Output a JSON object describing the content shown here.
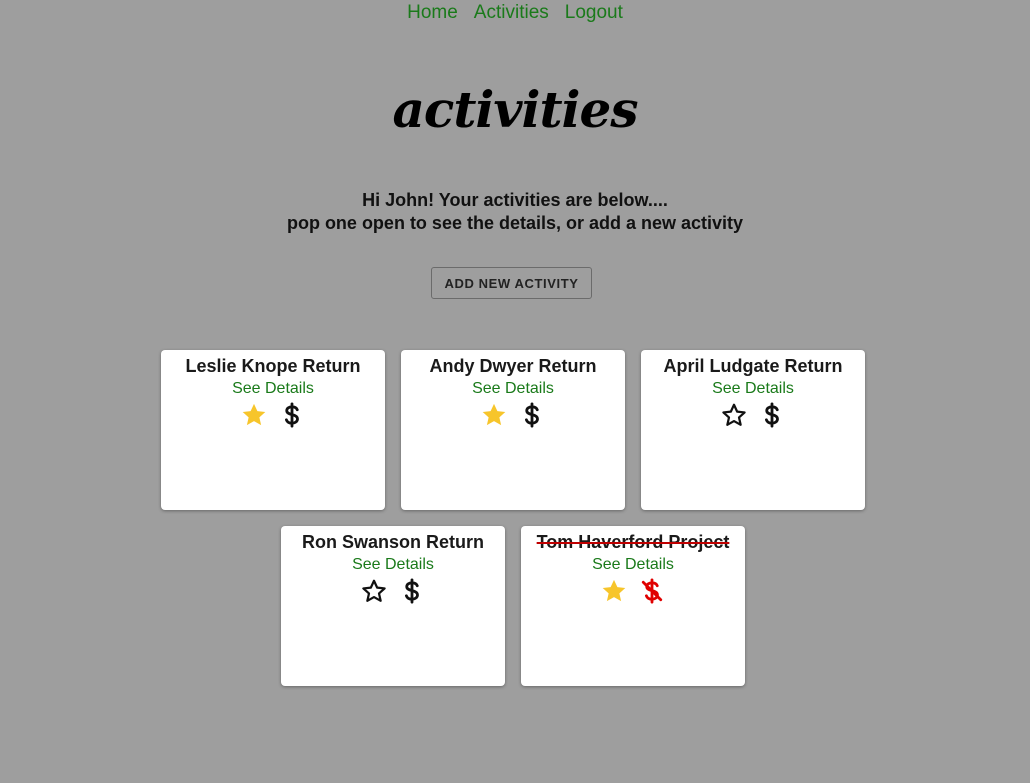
{
  "nav": {
    "links": [
      {
        "label": "Home"
      },
      {
        "label": "Activities"
      },
      {
        "label": "Logout"
      }
    ]
  },
  "page": {
    "title": "activities",
    "greeting_line1": "Hi John! Your activities are below....",
    "greeting_line2": "pop one open to see the details, or add a new activity",
    "add_button_label": "ADD NEW ACTIVITY"
  },
  "colors": {
    "link_green": "#1a7a1a",
    "star_gold": "#f7c52b",
    "no_money_red": "#e00000",
    "background": "#9e9e9e"
  },
  "activities": [
    {
      "title": "Leslie Knope Return",
      "details_label": "See Details",
      "starred": true,
      "paid": true,
      "completed": false
    },
    {
      "title": "Andy Dwyer Return",
      "details_label": "See Details",
      "starred": true,
      "paid": true,
      "completed": false
    },
    {
      "title": "April Ludgate Return",
      "details_label": "See Details",
      "starred": false,
      "paid": true,
      "completed": false
    },
    {
      "title": "Ron Swanson Return",
      "details_label": "See Details",
      "starred": false,
      "paid": true,
      "completed": false
    },
    {
      "title": "Tom Haverford Project",
      "details_label": "See Details",
      "starred": true,
      "paid": false,
      "completed": true
    }
  ]
}
